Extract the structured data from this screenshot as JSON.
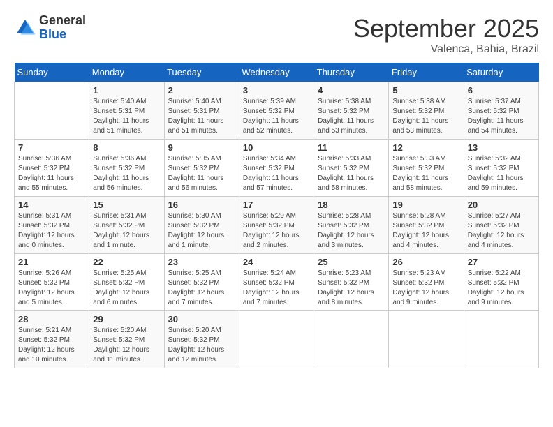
{
  "header": {
    "logo_general": "General",
    "logo_blue": "Blue",
    "month": "September 2025",
    "location": "Valenca, Bahia, Brazil"
  },
  "weekdays": [
    "Sunday",
    "Monday",
    "Tuesday",
    "Wednesday",
    "Thursday",
    "Friday",
    "Saturday"
  ],
  "weeks": [
    [
      {
        "num": "",
        "detail": ""
      },
      {
        "num": "1",
        "detail": "Sunrise: 5:40 AM\nSunset: 5:31 PM\nDaylight: 11 hours\nand 51 minutes."
      },
      {
        "num": "2",
        "detail": "Sunrise: 5:40 AM\nSunset: 5:31 PM\nDaylight: 11 hours\nand 51 minutes."
      },
      {
        "num": "3",
        "detail": "Sunrise: 5:39 AM\nSunset: 5:32 PM\nDaylight: 11 hours\nand 52 minutes."
      },
      {
        "num": "4",
        "detail": "Sunrise: 5:38 AM\nSunset: 5:32 PM\nDaylight: 11 hours\nand 53 minutes."
      },
      {
        "num": "5",
        "detail": "Sunrise: 5:38 AM\nSunset: 5:32 PM\nDaylight: 11 hours\nand 53 minutes."
      },
      {
        "num": "6",
        "detail": "Sunrise: 5:37 AM\nSunset: 5:32 PM\nDaylight: 11 hours\nand 54 minutes."
      }
    ],
    [
      {
        "num": "7",
        "detail": "Sunrise: 5:36 AM\nSunset: 5:32 PM\nDaylight: 11 hours\nand 55 minutes."
      },
      {
        "num": "8",
        "detail": "Sunrise: 5:36 AM\nSunset: 5:32 PM\nDaylight: 11 hours\nand 56 minutes."
      },
      {
        "num": "9",
        "detail": "Sunrise: 5:35 AM\nSunset: 5:32 PM\nDaylight: 11 hours\nand 56 minutes."
      },
      {
        "num": "10",
        "detail": "Sunrise: 5:34 AM\nSunset: 5:32 PM\nDaylight: 11 hours\nand 57 minutes."
      },
      {
        "num": "11",
        "detail": "Sunrise: 5:33 AM\nSunset: 5:32 PM\nDaylight: 11 hours\nand 58 minutes."
      },
      {
        "num": "12",
        "detail": "Sunrise: 5:33 AM\nSunset: 5:32 PM\nDaylight: 11 hours\nand 58 minutes."
      },
      {
        "num": "13",
        "detail": "Sunrise: 5:32 AM\nSunset: 5:32 PM\nDaylight: 11 hours\nand 59 minutes."
      }
    ],
    [
      {
        "num": "14",
        "detail": "Sunrise: 5:31 AM\nSunset: 5:32 PM\nDaylight: 12 hours\nand 0 minutes."
      },
      {
        "num": "15",
        "detail": "Sunrise: 5:31 AM\nSunset: 5:32 PM\nDaylight: 12 hours\nand 1 minute."
      },
      {
        "num": "16",
        "detail": "Sunrise: 5:30 AM\nSunset: 5:32 PM\nDaylight: 12 hours\nand 1 minute."
      },
      {
        "num": "17",
        "detail": "Sunrise: 5:29 AM\nSunset: 5:32 PM\nDaylight: 12 hours\nand 2 minutes."
      },
      {
        "num": "18",
        "detail": "Sunrise: 5:28 AM\nSunset: 5:32 PM\nDaylight: 12 hours\nand 3 minutes."
      },
      {
        "num": "19",
        "detail": "Sunrise: 5:28 AM\nSunset: 5:32 PM\nDaylight: 12 hours\nand 4 minutes."
      },
      {
        "num": "20",
        "detail": "Sunrise: 5:27 AM\nSunset: 5:32 PM\nDaylight: 12 hours\nand 4 minutes."
      }
    ],
    [
      {
        "num": "21",
        "detail": "Sunrise: 5:26 AM\nSunset: 5:32 PM\nDaylight: 12 hours\nand 5 minutes."
      },
      {
        "num": "22",
        "detail": "Sunrise: 5:25 AM\nSunset: 5:32 PM\nDaylight: 12 hours\nand 6 minutes."
      },
      {
        "num": "23",
        "detail": "Sunrise: 5:25 AM\nSunset: 5:32 PM\nDaylight: 12 hours\nand 7 minutes."
      },
      {
        "num": "24",
        "detail": "Sunrise: 5:24 AM\nSunset: 5:32 PM\nDaylight: 12 hours\nand 7 minutes."
      },
      {
        "num": "25",
        "detail": "Sunrise: 5:23 AM\nSunset: 5:32 PM\nDaylight: 12 hours\nand 8 minutes."
      },
      {
        "num": "26",
        "detail": "Sunrise: 5:23 AM\nSunset: 5:32 PM\nDaylight: 12 hours\nand 9 minutes."
      },
      {
        "num": "27",
        "detail": "Sunrise: 5:22 AM\nSunset: 5:32 PM\nDaylight: 12 hours\nand 9 minutes."
      }
    ],
    [
      {
        "num": "28",
        "detail": "Sunrise: 5:21 AM\nSunset: 5:32 PM\nDaylight: 12 hours\nand 10 minutes."
      },
      {
        "num": "29",
        "detail": "Sunrise: 5:20 AM\nSunset: 5:32 PM\nDaylight: 12 hours\nand 11 minutes."
      },
      {
        "num": "30",
        "detail": "Sunrise: 5:20 AM\nSunset: 5:32 PM\nDaylight: 12 hours\nand 12 minutes."
      },
      {
        "num": "",
        "detail": ""
      },
      {
        "num": "",
        "detail": ""
      },
      {
        "num": "",
        "detail": ""
      },
      {
        "num": "",
        "detail": ""
      }
    ]
  ]
}
